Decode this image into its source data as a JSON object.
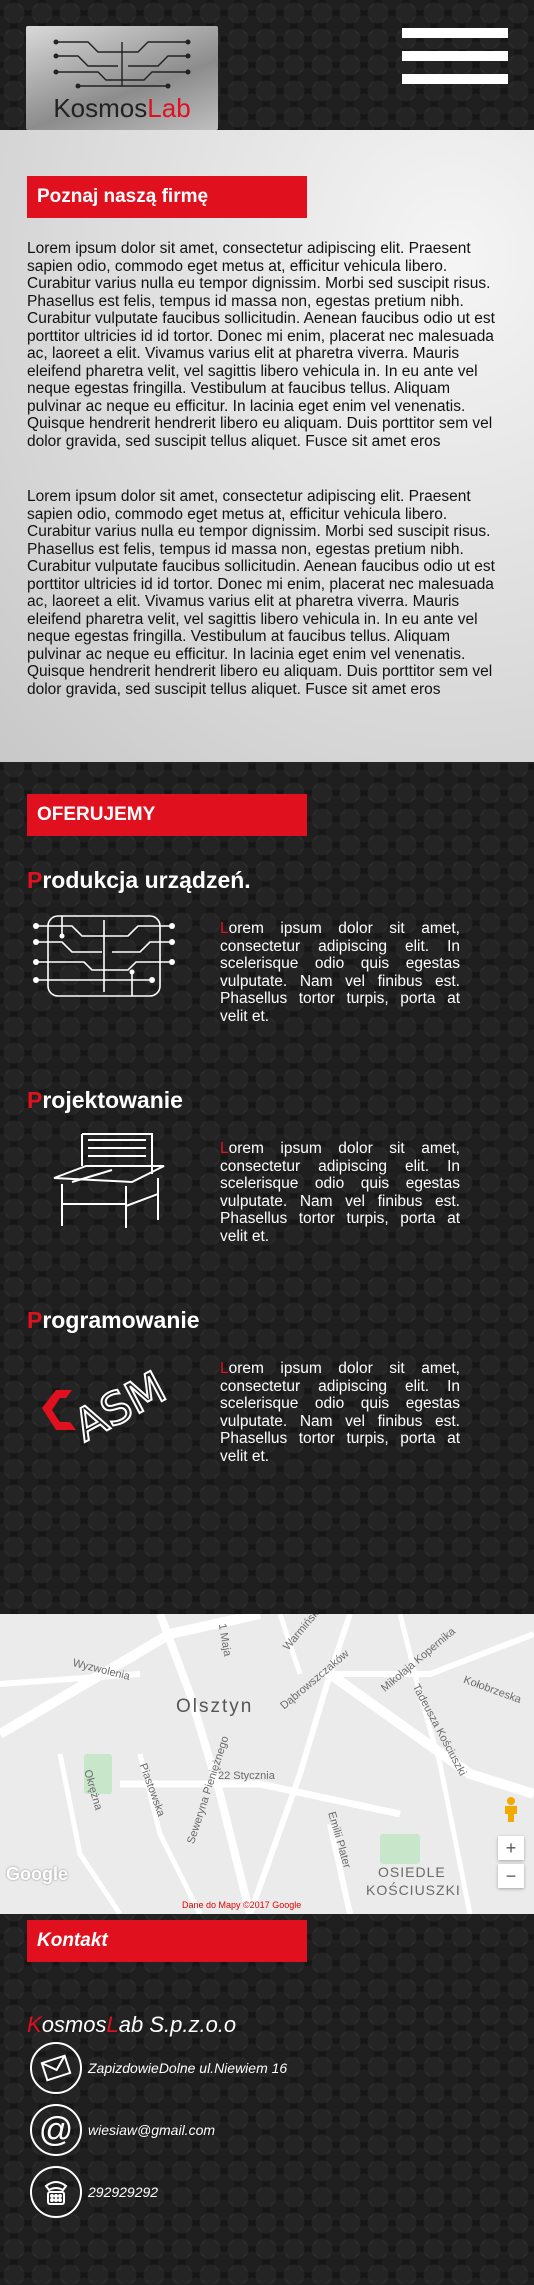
{
  "header": {
    "logo_part1": "Kosmos",
    "logo_part2": "L",
    "logo_part3": "ab"
  },
  "about": {
    "title": "Poznaj naszą firmę",
    "paragraph1": "Lorem ipsum dolor sit amet, consectetur adipiscing elit. Praesent sapien odio, commodo eget metus at, efficitur vehicula libero. Curabitur varius nulla eu tempor dignissim. Morbi sed suscipit risus. Phasellus est felis, tempus id massa non, egestas pretium nibh. Curabitur vulputate faucibus sollicitudin. Aenean faucibus odio ut est porttitor ultricies id id tortor. Donec mi enim, placerat nec malesuada ac, laoreet a elit. Vivamus varius elit at pharetra viverra. Mauris eleifend pharetra velit, vel sagittis libero vehicula in. In eu ante vel neque egestas fringilla. Vestibulum at faucibus tellus. Aliquam pulvinar ac neque eu efficitur. In lacinia eget enim vel venenatis. Quisque hendrerit hendrerit libero eu aliquam. Duis porttitor sem vel dolor gravida, sed suscipit tellus aliquet. Fusce sit amet eros",
    "paragraph2": "Lorem ipsum dolor sit amet, consectetur adipiscing elit. Praesent sapien odio, commodo eget metus at, efficitur vehicula libero. Curabitur varius nulla eu tempor dignissim. Morbi sed suscipit risus. Phasellus est felis, tempus id massa non, egestas pretium nibh. Curabitur vulputate faucibus sollicitudin. Aenean faucibus odio ut est porttitor ultricies id id tortor. Donec mi enim, placerat nec malesuada ac, laoreet a elit. Vivamus varius elit at pharetra viverra. Mauris eleifend pharetra velit, vel sagittis libero vehicula in. In eu ante vel neque egestas fringilla. Vestibulum at faucibus tellus. Aliquam pulvinar ac neque eu efficitur. In lacinia eget enim vel venenatis. Quisque hendrerit hendrerit libero eu aliquam. Duis porttitor sem vel dolor gravida, sed suscipit tellus aliquet. Fusce sit amet eros"
  },
  "offer": {
    "title": "OFERUJEMY",
    "services": [
      {
        "first_letter": "P",
        "rest": "rodukcja urządzeń.",
        "text_first": "L",
        "text_rest": "orem ipsum dolor sit amet, consectetur adipiscing elit. In scelerisque odio quis egestas vulputate. Nam vel finibus est. Phasellus tortor turpis, porta at velit et.",
        "icon": "circuit-board-icon"
      },
      {
        "first_letter": "P",
        "rest": "rojektowanie",
        "text_first": "L",
        "text_rest": "orem ipsum dolor sit amet, consectetur adipiscing elit. In scelerisque odio quis egestas vulputate. Nam vel finibus est. Phasellus tortor turpis, porta at velit et.",
        "icon": "drafting-desk-icon"
      },
      {
        "first_letter": "P",
        "rest": "rogramowanie",
        "text_first": "L",
        "text_rest": "orem ipsum dolor sit amet, consectetur adipiscing elit. In scelerisque odio quis egestas vulputate. Nam vel finibus est. Phasellus tortor turpis, porta at velit et.",
        "icon": "asm-logo-icon"
      }
    ]
  },
  "map": {
    "labels": [
      "Wyzwolenia",
      "1 Maja",
      "Warmińska",
      "Dąbrowszczaków",
      "Mikołaja Kopernika",
      "Kołobrzeska",
      "Olsztyn",
      "22 Stycznia",
      "Okrężna",
      "Piastowska",
      "Seweryna Pieniężnego",
      "Tadeusza Kościuszki",
      "Emilii Plater",
      "OSIEDLE",
      "KOŚCIUSZKI"
    ],
    "attribution": "Dane do Mapy ©2017 Google",
    "google_logo": "Google",
    "zoom_in": "+",
    "zoom_out": "−"
  },
  "contact": {
    "title": "Kontakt",
    "company_k": "K",
    "company_mid": "osmos",
    "company_l": "L",
    "company_rest": "ab S.p.z.o.o",
    "address": "ZapizdowieDolne ul.Niewiem 16",
    "email": "wiesiaw@gmail.com",
    "phone": "292929292"
  },
  "colors": {
    "accent": "#e0101e",
    "background": "#161616",
    "light_panel": "#d6d6d6"
  }
}
